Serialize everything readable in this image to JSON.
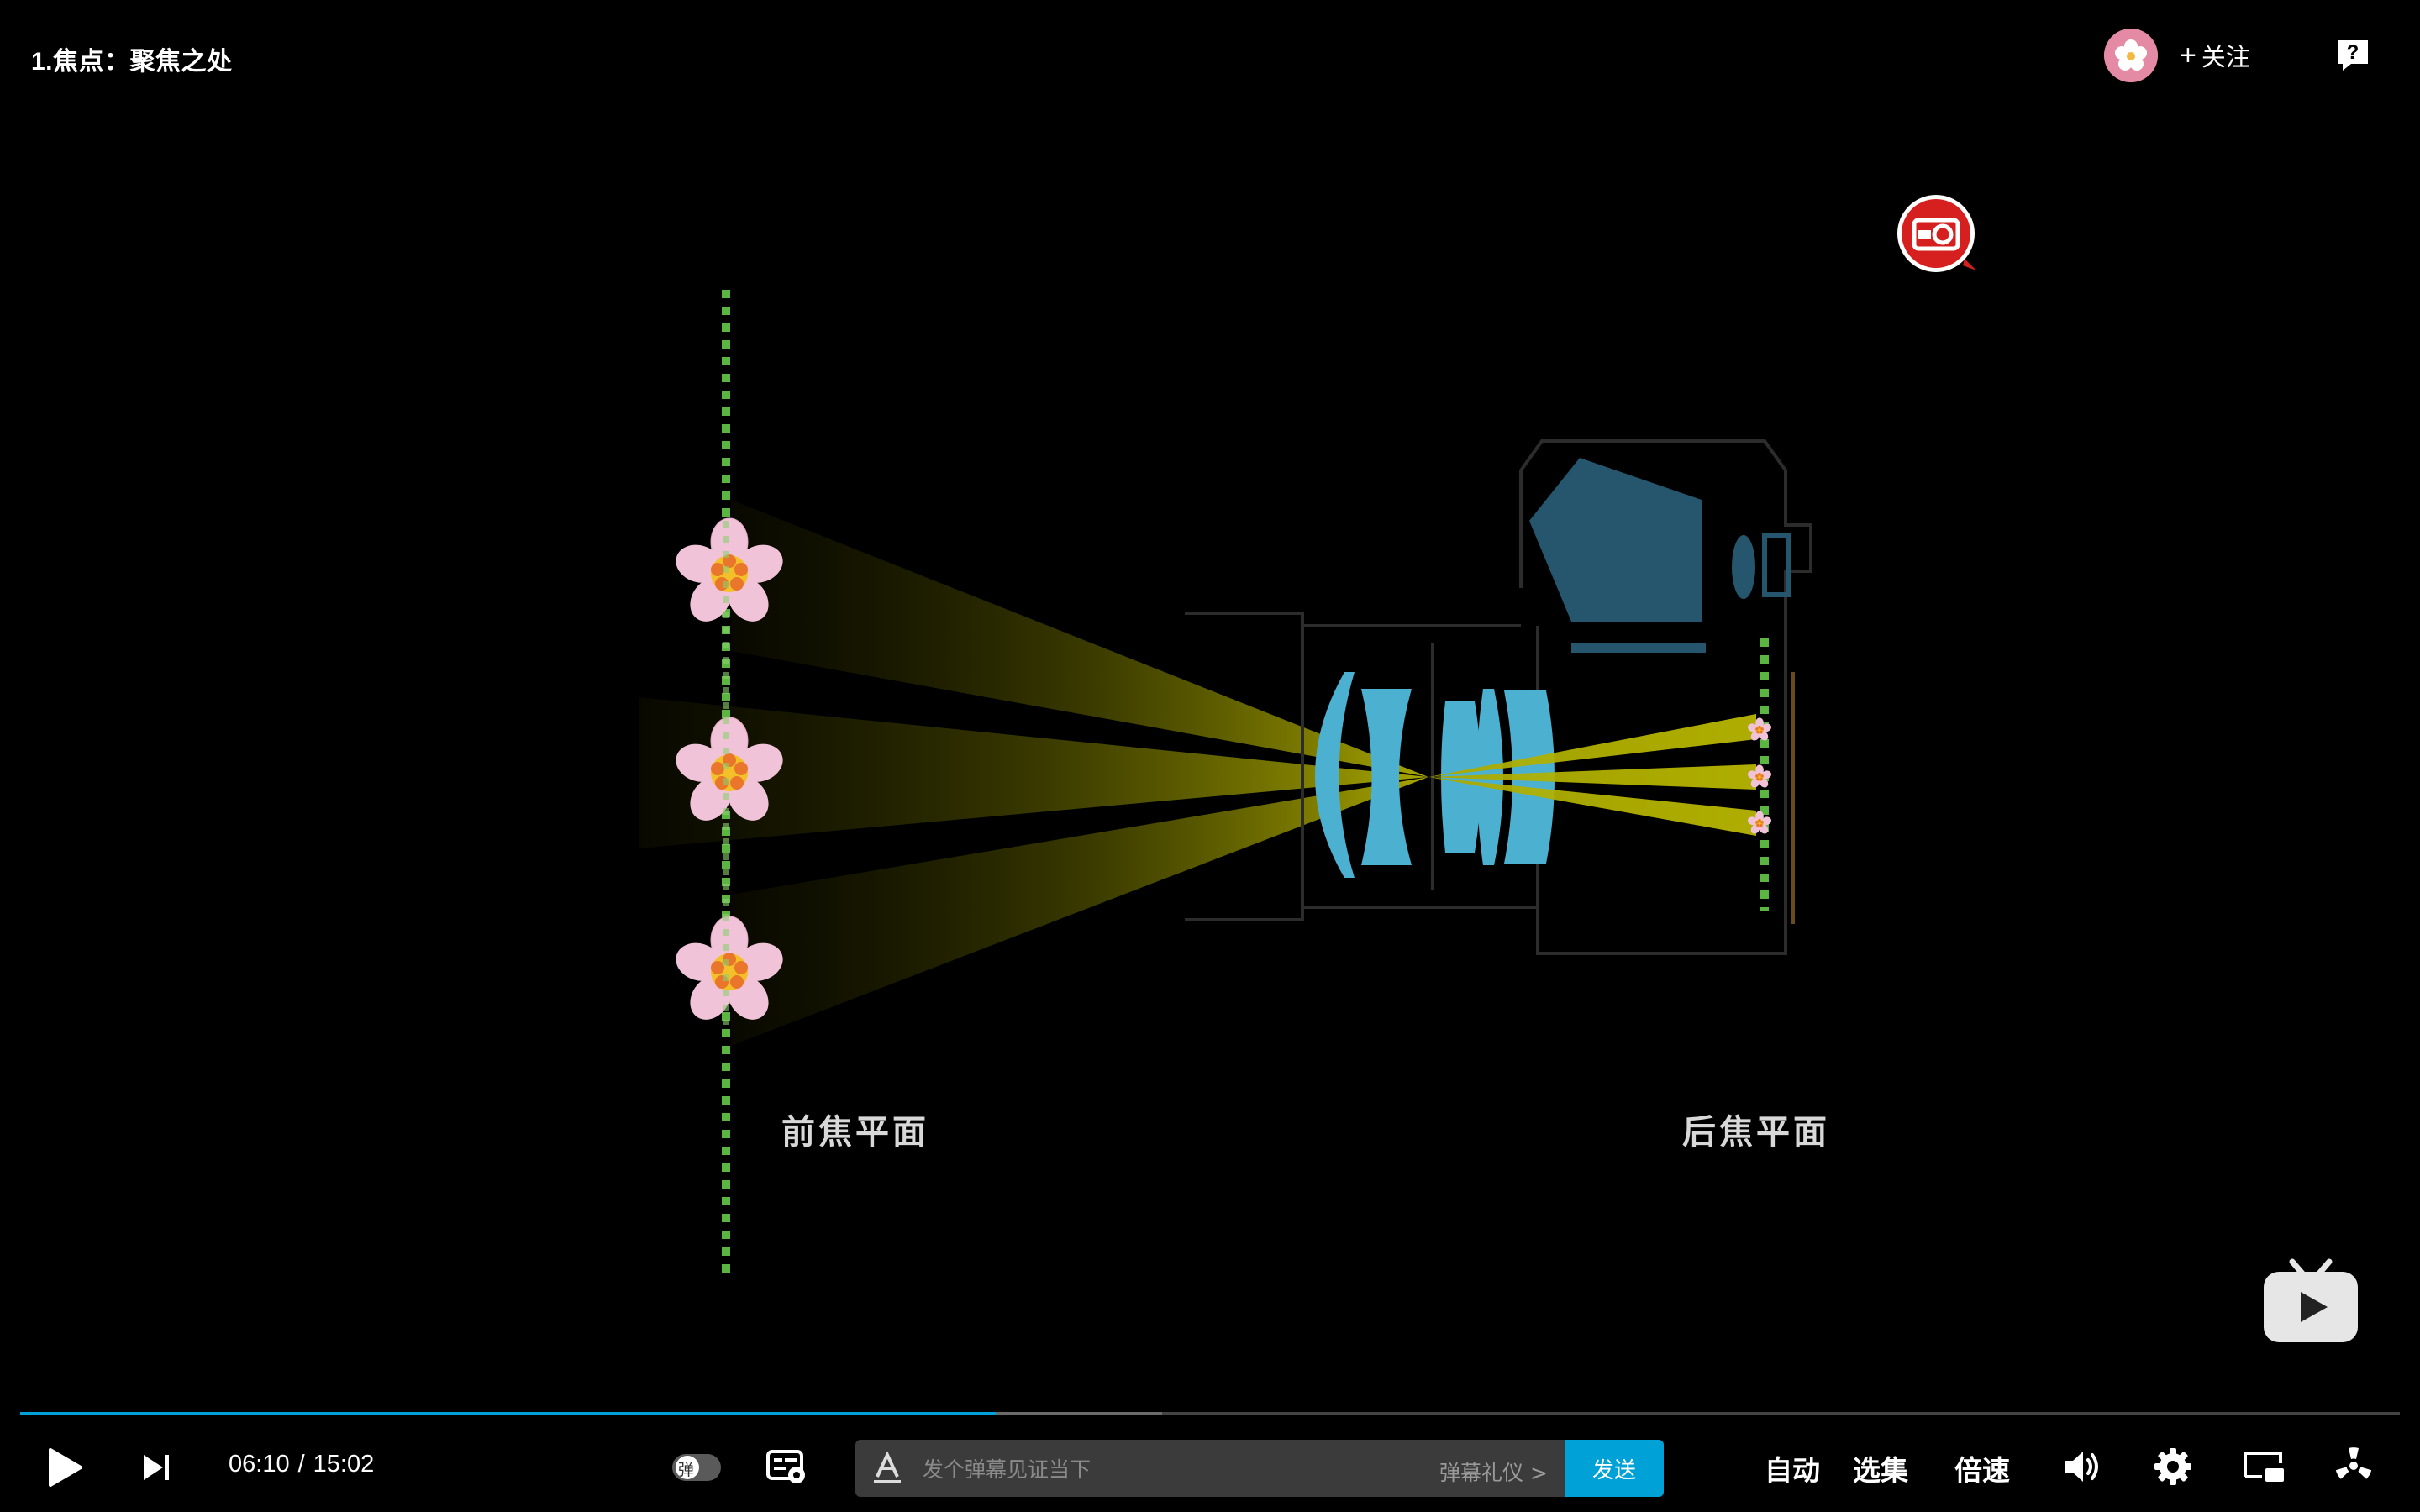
{
  "video": {
    "title": "1.焦点：聚焦之处",
    "follow_label": "关注",
    "scene": {
      "front_label": "前焦平面",
      "back_label": "后焦平面"
    }
  },
  "player": {
    "current_time": "06:10",
    "separator": "/",
    "duration": "15:02",
    "progress_played": 0.41,
    "progress_buffered": 0.48,
    "danmaku_placeholder": "发个弹幕见证当下",
    "danmaku_etiquette": "弹幕礼仪 >",
    "send_label": "发送",
    "auto_label": "自动",
    "episodes_label": "选集",
    "speed_label": "倍速",
    "danmaku_toggle_glyph": "弹"
  },
  "colors": {
    "accent": "#00a1d6",
    "background": "#000000",
    "flower": "#f1c3d8",
    "lens": "#4cb0d0",
    "light_beam": "#a8a800",
    "focus_plane": "#5ab541"
  }
}
